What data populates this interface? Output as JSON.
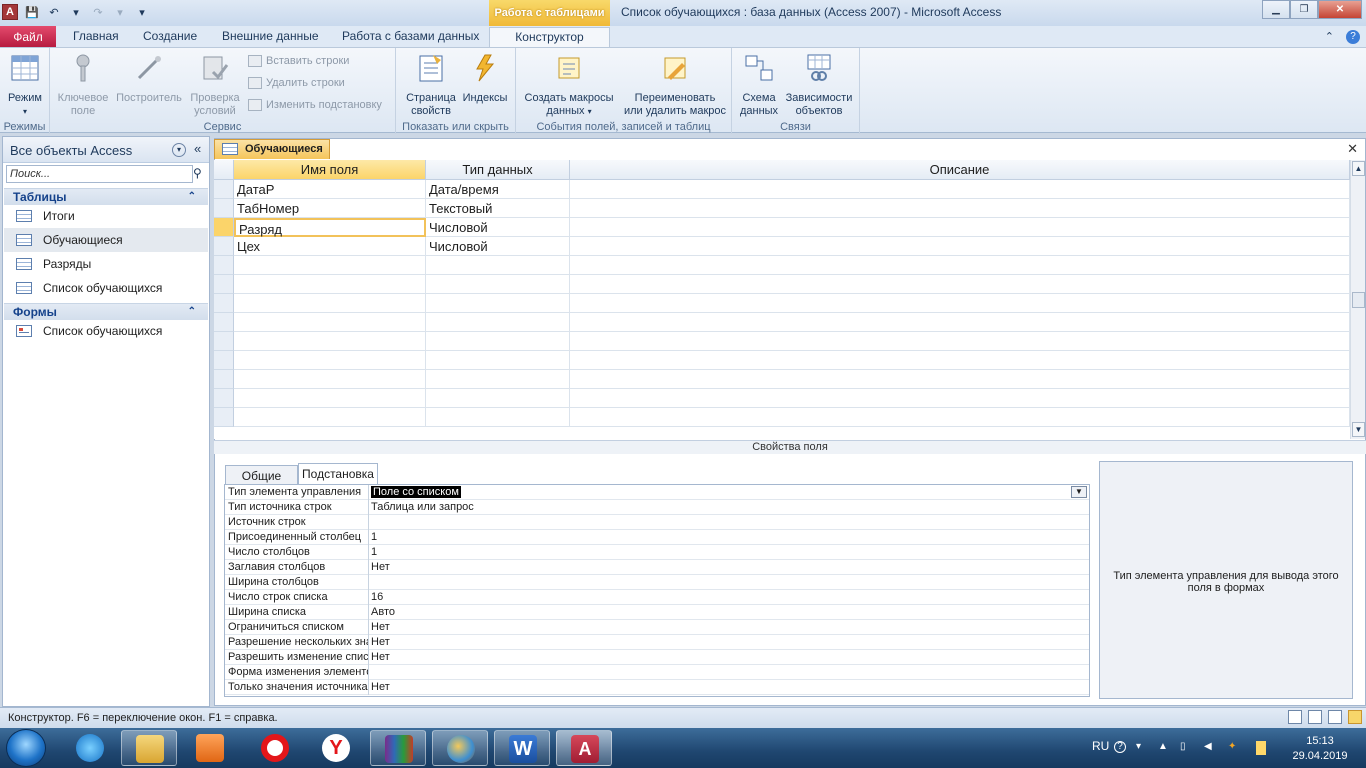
{
  "window": {
    "title": "Список обучающихся : база данных (Access 2007)  -  Microsoft Access",
    "context_tab_header": "Работа с таблицами",
    "qat": [
      "A",
      "💾",
      "↶",
      "▾",
      "↷",
      "▾",
      "▾"
    ]
  },
  "tabs": {
    "file": "Файл",
    "home": "Главная",
    "create": "Создание",
    "external": "Внешние данные",
    "database": "Работа с базами данных",
    "design": "Конструктор"
  },
  "ribbon": {
    "views_group": "Режимы",
    "view_btn": "Режим",
    "tools_group": "Сервис",
    "primary_key_btn_1": "Ключевое",
    "primary_key_btn_2": "поле",
    "builder_btn": "Построитель",
    "test_rules_btn_1": "Проверка",
    "test_rules_btn_2": "условий",
    "insert_rows": "Вставить строки",
    "delete_rows": "Удалить строки",
    "modify_lookups": "Изменить подстановку",
    "showhide_group": "Показать или скрыть",
    "property_sheet_btn_1": "Страница",
    "property_sheet_btn_2": "свойств",
    "indexes_btn": "Индексы",
    "events_group": "События полей, записей и таблиц",
    "create_macros_btn_1": "Создать макросы",
    "create_macros_btn_2": "данных",
    "rename_macro_btn_1": "Переименовать",
    "rename_macro_btn_2": "или удалить макрос",
    "relations_group": "Связи",
    "relationships_btn_1": "Схема",
    "relationships_btn_2": "данных",
    "dependencies_btn_1": "Зависимости",
    "dependencies_btn_2": "объектов"
  },
  "nav": {
    "title": "Все объекты Access",
    "search_placeholder": "Поиск...",
    "groups": [
      {
        "label": "Таблицы",
        "items": [
          "Итоги",
          "Обучающиеся",
          "Разряды",
          "Список обучающихся"
        ]
      },
      {
        "label": "Формы",
        "items": [
          "Список обучающихся"
        ]
      }
    ]
  },
  "document": {
    "tab_label": "Обучающиеся",
    "columns": [
      "Имя поля",
      "Тип данных",
      "Описание"
    ],
    "rows": [
      {
        "name": "ДатаР",
        "type": "Дата/время"
      },
      {
        "name": "ТабНомер",
        "type": "Текстовый"
      },
      {
        "name": "Разряд",
        "type": "Числовой"
      },
      {
        "name": "Цех",
        "type": "Числовой"
      }
    ],
    "props_title": "Свойства поля",
    "prop_tabs": [
      "Общие",
      "Подстановка"
    ],
    "properties": [
      {
        "name": "Тип элемента управления",
        "value": "Поле со списком"
      },
      {
        "name": "Тип источника строк",
        "value": "Таблица или запрос"
      },
      {
        "name": "Источник строк",
        "value": ""
      },
      {
        "name": "Присоединенный столбец",
        "value": "1"
      },
      {
        "name": "Число столбцов",
        "value": "1"
      },
      {
        "name": "Заглавия столбцов",
        "value": "Нет"
      },
      {
        "name": "Ширина столбцов",
        "value": ""
      },
      {
        "name": "Число строк списка",
        "value": "16"
      },
      {
        "name": "Ширина списка",
        "value": "Авто"
      },
      {
        "name": "Ограничиться списком",
        "value": "Нет"
      },
      {
        "name": "Разрешение нескольких значений",
        "value": "Нет"
      },
      {
        "name": "Разрешить изменение списка значений",
        "value": "Нет"
      },
      {
        "name": "Форма изменения элементов списка",
        "value": ""
      },
      {
        "name": "Только значения источника строк",
        "value": "Нет"
      }
    ],
    "help_text": "Тип элемента управления для вывода этого поля в формах"
  },
  "status": {
    "text": "Конструктор.  F6 = переключение окон.  F1 = справка."
  },
  "taskbar": {
    "lang": "RU",
    "time": "15:13",
    "date": "29.04.2019"
  }
}
